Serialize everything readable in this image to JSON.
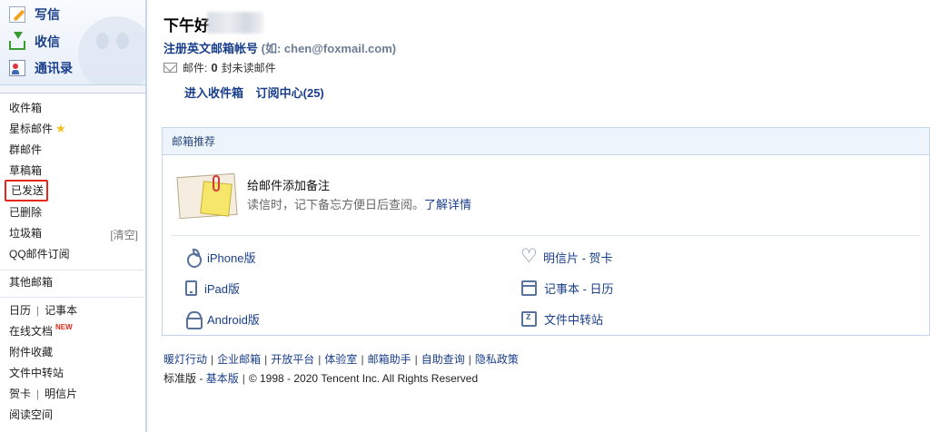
{
  "sidebar": {
    "actions": {
      "write": "写信",
      "inbox": "收信",
      "contacts": "通讯录"
    },
    "folders": {
      "inbox": "收件箱",
      "starred": "星标邮件",
      "group": "群邮件",
      "drafts": "草稿箱",
      "sent": "已发送",
      "deleted": "已删除",
      "trash": "垃圾箱",
      "trash_clear": "[清空]",
      "qq_subscription": "QQ邮件订阅"
    },
    "other_mailboxes": "其他邮箱",
    "tools": {
      "calendar": "日历",
      "notebook": "记事本",
      "online_docs": "在线文档",
      "new_badge": "NEW",
      "attachments": "附件收藏",
      "file_transfer": "文件中转站",
      "greeting_card": "贺卡",
      "postcard": "明信片",
      "reading_space": "阅读空间"
    }
  },
  "main": {
    "greeting": "下午好",
    "account": {
      "register_label": "注册英文邮箱帐号",
      "hint": "(如: chen@foxmail.com)"
    },
    "mail_status": {
      "prefix": "邮件:",
      "count": "0",
      "suffix": "封未读邮件"
    },
    "links": {
      "enter_inbox": "进入收件箱",
      "subscription_center": "订阅中心(25)"
    },
    "recommend": {
      "title": "邮箱推荐",
      "tip_title": "给邮件添加备注",
      "tip_desc": "读信时，记下备忘方便日后查阅。",
      "tip_more": "了解详情",
      "apps": {
        "iphone": "iPhone版",
        "ipad": "iPad版",
        "android": "Android版",
        "postcard": "明信片 - 贺卡",
        "notebook": "记事本 - 日历",
        "transfer": "文件中转站"
      }
    }
  },
  "footer": {
    "links": [
      "暖灯行动",
      "企业邮箱",
      "开放平台",
      "体验室",
      "邮箱助手",
      "自助查询",
      "隐私政策"
    ],
    "standard": "标准版",
    "basic": "基本版",
    "copyright": "© 1998 - 2020 Tencent Inc. All Rights Reserved"
  },
  "colors": {
    "link": "#1a3f8a",
    "sidebar_bg": "#f3f6fb",
    "selected_outline": "#e3271d"
  }
}
